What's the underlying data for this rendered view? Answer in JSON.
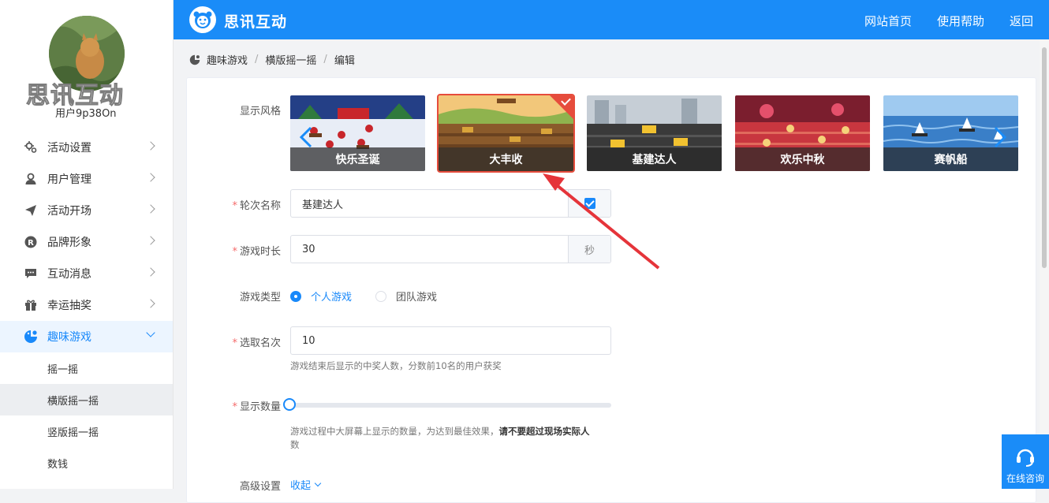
{
  "sidebar": {
    "brand_watermark": "思讯互动",
    "username": "用户9p38On",
    "menu": [
      {
        "label": "活动设置",
        "icon": "gear-icon"
      },
      {
        "label": "用户管理",
        "icon": "user-icon"
      },
      {
        "label": "活动开场",
        "icon": "paper-plane-icon"
      },
      {
        "label": "品牌形象",
        "icon": "registered-icon"
      },
      {
        "label": "互动消息",
        "icon": "chat-icon"
      },
      {
        "label": "幸运抽奖",
        "icon": "gift-icon"
      },
      {
        "label": "趣味游戏",
        "icon": "game-icon"
      }
    ],
    "submenu": [
      "摇一摇",
      "横版摇一摇",
      "竖版摇一摇",
      "数钱"
    ]
  },
  "header": {
    "logo_text": "思讯互动",
    "links": [
      "网站首页",
      "使用帮助",
      "返回"
    ]
  },
  "breadcrumb": [
    "趣味游戏",
    "横版摇一摇",
    "编辑"
  ],
  "form": {
    "style_label": "显示风格",
    "styles": [
      {
        "name": "快乐圣诞",
        "selected": false,
        "palette": [
          "#1d3a78",
          "#e9eef7",
          "#c8262b"
        ]
      },
      {
        "name": "大丰收",
        "selected": true,
        "palette": [
          "#e8b35a",
          "#8a5a2b",
          "#5c3a1a"
        ]
      },
      {
        "name": "基建达人",
        "selected": false,
        "palette": [
          "#b9c3cc",
          "#3b3b3b",
          "#f2c230"
        ]
      },
      {
        "name": "欢乐中秋",
        "selected": false,
        "palette": [
          "#7b1e2e",
          "#d9434c",
          "#f0a35a"
        ]
      },
      {
        "name": "赛帆船",
        "selected": false,
        "palette": [
          "#7fb6e8",
          "#2f6fb8",
          "#e9f2fb"
        ]
      }
    ],
    "round_name": {
      "label": "轮次名称",
      "value": "基建达人"
    },
    "duration": {
      "label": "游戏时长",
      "value": "30",
      "unit": "秒"
    },
    "game_type": {
      "label": "游戏类型",
      "options": [
        "个人游戏",
        "团队游戏"
      ],
      "selected": "个人游戏"
    },
    "winners": {
      "label": "选取名次",
      "value": "10",
      "hint": "游戏结束后显示的中奖人数，分数前10名的用户获奖"
    },
    "display_count": {
      "label": "显示数量",
      "value_fraction": 0,
      "hint_prefix": "游戏过程中大屏幕上显示的数量，为达到最佳效果，",
      "hint_bold": "请不要超过现场实际人",
      "hint_end": "数"
    },
    "advanced": {
      "label": "高级设置",
      "toggle": "收起"
    }
  },
  "consult_label": "在线咨询",
  "colors": {
    "primary": "#1a8cf8",
    "danger": "#e64c3c",
    "active_bg": "#ecf5ff"
  }
}
